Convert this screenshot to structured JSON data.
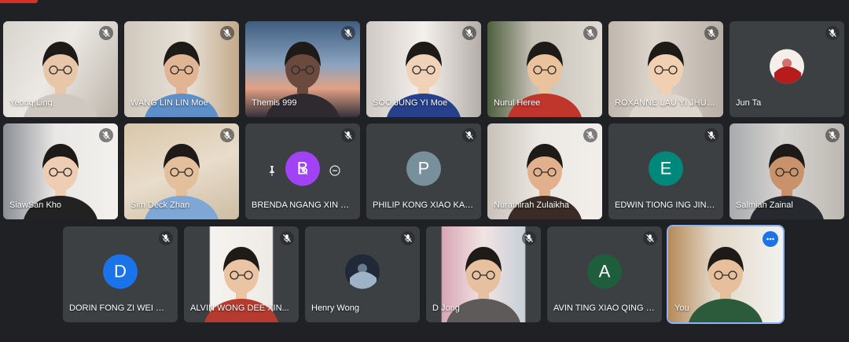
{
  "meeting": {
    "participants": [
      {
        "name": "Yeong Ling",
        "muted": true,
        "video": true,
        "scene": "room-warm",
        "skin": "#e8c7a8",
        "shirt": "#cfc8c0"
      },
      {
        "name": "WANG LIN LIN Moe",
        "muted": true,
        "video": true,
        "scene": "shelf",
        "skin": "#e1b594",
        "shirt": "#5f8fc9"
      },
      {
        "name": "Themis 999",
        "muted": true,
        "video": true,
        "scene": "sunset",
        "skin": "#6a4a3c",
        "shirt": "#2e2a30"
      },
      {
        "name": "SOO JUNG YI Moe",
        "muted": true,
        "video": true,
        "scene": "light",
        "skin": "#f0d2b8",
        "shirt": "#27408b"
      },
      {
        "name": "Nurul Heree",
        "muted": true,
        "video": true,
        "scene": "plants",
        "skin": "#eac39d",
        "shirt": "#c0352c"
      },
      {
        "name": "ROXANNE LAU YI JHUN...",
        "muted": true,
        "video": true,
        "scene": "curtain",
        "skin": "#f1d0b2",
        "shirt": "#ded6cc"
      },
      {
        "name": "Jun Ta",
        "muted": true,
        "video": false,
        "avatar_type": "photo",
        "avatar_colors": [
          "#f4efe8",
          "#b71c1c"
        ]
      },
      {
        "name": "SiawSan Kho",
        "muted": true,
        "video": true,
        "scene": "window",
        "skin": "#efcdb2",
        "shirt": "#222222"
      },
      {
        "name": "Sim Deck Zhan",
        "muted": true,
        "video": true,
        "scene": "wall-art",
        "skin": "#e4bf9c",
        "shirt": "#7fa7d6"
      },
      {
        "name": "BRENDA NGANG XIN HU...",
        "muted": true,
        "video": false,
        "avatar_type": "letter",
        "letter": "B",
        "avatar_color": "#a142f4",
        "hover": true
      },
      {
        "name": "PHILIP KONG XIAO KAN...",
        "muted": true,
        "video": false,
        "avatar_type": "letter",
        "letter": "P",
        "avatar_color": "#78909c"
      },
      {
        "name": "Nurathirah Zulaikha",
        "muted": true,
        "video": true,
        "scene": "shelf-white",
        "skin": "#e2b08c",
        "shirt": "#3a2b26"
      },
      {
        "name": "EDWIN TIONG ING JING ...",
        "muted": true,
        "video": false,
        "avatar_type": "letter",
        "letter": "E",
        "avatar_color": "#00897b"
      },
      {
        "name": "Salmiah Zainal",
        "muted": true,
        "video": true,
        "scene": "grey-room",
        "skin": "#c9926b",
        "shirt": "#262a2e"
      },
      {
        "name": "DORIN FONG ZI WEI Moe",
        "muted": true,
        "video": false,
        "avatar_type": "letter",
        "letter": "D",
        "avatar_color": "#1a73e8"
      },
      {
        "name": "ALVIN WONG DEE XIN...",
        "muted": true,
        "video": true,
        "scene": "white-portrait",
        "skin": "#eac4a3",
        "shirt": "#b63a2e"
      },
      {
        "name": "Henry Wong",
        "muted": true,
        "video": false,
        "avatar_type": "photo",
        "avatar_colors": [
          "#1f2937",
          "#9fb3c8"
        ]
      },
      {
        "name": "D Jong",
        "muted": true,
        "video": true,
        "scene": "curtain-pink",
        "skin": "#e7c09f",
        "shirt": "#5e5a5a"
      },
      {
        "name": "AVIN TING XIAO QING M...",
        "muted": true,
        "video": false,
        "avatar_type": "letter",
        "letter": "A",
        "avatar_color": "#1e5e3c"
      },
      {
        "name": "You",
        "muted": false,
        "video": true,
        "scene": "kitchen",
        "skin": "#e7bf9b",
        "shirt": "#2b5b3a",
        "self": true,
        "more_menu": true
      }
    ],
    "colors": {
      "background": "#202124",
      "tile": "#3c4043",
      "self_border": "#8ab4f8",
      "more_button": "#1a73e8"
    }
  }
}
